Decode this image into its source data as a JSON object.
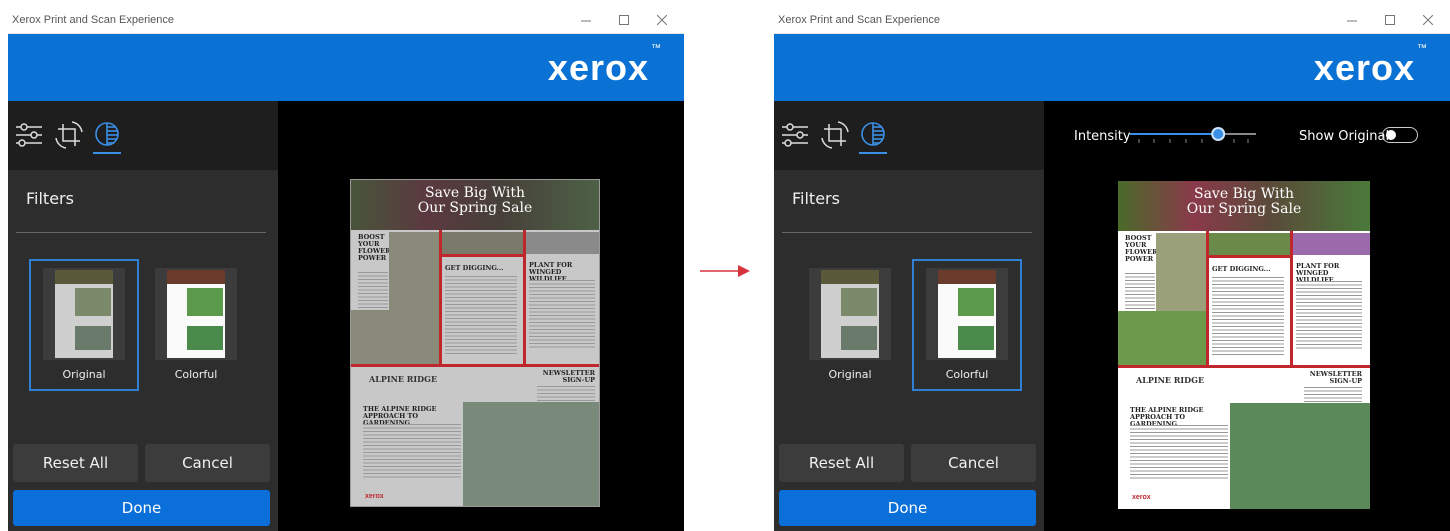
{
  "app": {
    "window_title": "Xerox Print and Scan Experience",
    "brand": "xerox",
    "trademark": "™"
  },
  "filters_panel": {
    "title": "Filters",
    "options": [
      {
        "label": "Original"
      },
      {
        "label": "Colorful"
      }
    ]
  },
  "buttons": {
    "reset_all": "Reset All",
    "cancel": "Cancel",
    "done": "Done"
  },
  "adjust": {
    "intensity_label": "Intensity",
    "intensity_value": 0.7,
    "show_original_label": "Show Original"
  },
  "document": {
    "headline_line1": "Save Big With",
    "headline_line2": "Our Spring Sale",
    "sections": {
      "boost": "BOOST YOUR FLOWER POWER",
      "digging": "GET DIGGING...",
      "wildlife": "PLANT FOR WINGED WILDLIFE",
      "brand": "ALPINE RIDGE",
      "approach": "THE ALPINE RIDGE APPROACH TO GARDENING",
      "newsletter": "NEWSLETTER SIGN-UP",
      "footer_logo": "xerox"
    }
  },
  "states": {
    "left": {
      "selected_filter": "Original"
    },
    "right": {
      "selected_filter": "Colorful"
    }
  },
  "colors": {
    "accent": "#0a72d4",
    "done_button": "#0a6fd8",
    "selection_border": "#2f7fd2",
    "arrow": "#d6323c",
    "doc_red": "#c0272d"
  }
}
